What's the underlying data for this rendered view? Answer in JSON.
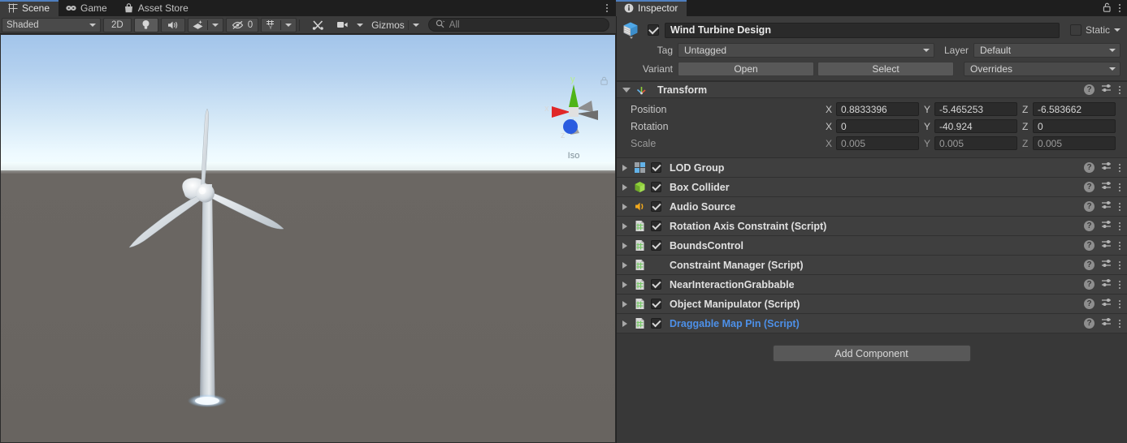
{
  "scene_panel": {
    "tabs": [
      {
        "label": "Scene",
        "icon": "grid-icon",
        "active": true
      },
      {
        "label": "Game",
        "icon": "gamepad-icon",
        "active": false
      },
      {
        "label": "Asset Store",
        "icon": "store-bag-icon",
        "active": false
      }
    ],
    "panel_menu_icon": "kebab-menu-icon",
    "toolbar": {
      "draw_mode": "Shaded",
      "two_d_label": "2D",
      "lighting_icon": "lightbulb-icon",
      "audio_icon": "speaker-icon",
      "fx_icon": "effects-icon",
      "hidden_count": "0",
      "hidden_icon": "eye-slash-icon",
      "grid_icon": "grid-snap-icon",
      "tools_icon": "tools-icon",
      "camera_icon": "camera-icon",
      "gizmos_label": "Gizmos",
      "search_placeholder": "All",
      "search_value": "",
      "search_icon": "search-icon"
    },
    "viewport": {
      "gizmo": {
        "x_label": "x",
        "y_label": "y",
        "z_label": "z",
        "projection": "Iso",
        "lock_icon": "padlock-icon",
        "x_color": "#e02828",
        "y_color": "#4fb417",
        "z_color": "#2a5ce0"
      },
      "sky_top_color": "#a2c4ea",
      "sky_bottom_color": "#f4feff",
      "ground_color": "#6a6662",
      "object_name": "wind-turbine-model"
    }
  },
  "inspector": {
    "tab": {
      "label": "Inspector",
      "icon": "info-icon"
    },
    "lock_icon": "padlock-open-icon",
    "menu_icon": "kebab-menu-icon",
    "object": {
      "enabled": true,
      "name": "Wind Turbine Design",
      "icon": "prefab-cube-icon",
      "static_label": "Static",
      "static_checked": false
    },
    "tag": {
      "label": "Tag",
      "value": "Untagged"
    },
    "layer": {
      "label": "Layer",
      "value": "Default"
    },
    "variant": {
      "label": "Variant",
      "open_label": "Open",
      "select_label": "Select",
      "overrides_label": "Overrides"
    },
    "transform": {
      "title": "Transform",
      "icon": "transform-axes-icon",
      "expanded": true,
      "help_icon": "help-icon",
      "preset_icon": "preset-sliders-icon",
      "menu_icon": "kebab-menu-icon",
      "rows": [
        {
          "name": "Position",
          "dim": false,
          "x": "0.8833396",
          "y": "-5.465253",
          "z": "-6.583662"
        },
        {
          "name": "Rotation",
          "dim": false,
          "x": "0",
          "y": "-40.924",
          "z": "0"
        },
        {
          "name": "Scale",
          "dim": true,
          "x": "0.005",
          "y": "0.005",
          "z": "0.005"
        }
      ],
      "axis_labels": {
        "x": "X",
        "y": "Y",
        "z": "Z"
      }
    },
    "components": [
      {
        "name": "LOD Group",
        "icon": "lod-group-icon",
        "icon_color": "#63b2e8",
        "checkbox": true,
        "checked": true,
        "highlight": false
      },
      {
        "name": "Box Collider",
        "icon": "box-collider-icon",
        "icon_color": "#8fd03a",
        "checkbox": true,
        "checked": true,
        "highlight": false
      },
      {
        "name": "Audio Source",
        "icon": "audio-source-icon",
        "icon_color": "#f0a81e",
        "checkbox": true,
        "checked": true,
        "highlight": false
      },
      {
        "name": "Rotation Axis Constraint (Script)",
        "icon": "script-icon",
        "icon_color": "#7ac96a",
        "checkbox": true,
        "checked": true,
        "highlight": false
      },
      {
        "name": "BoundsControl",
        "icon": "script-icon",
        "icon_color": "#7ac96a",
        "checkbox": true,
        "checked": true,
        "highlight": false
      },
      {
        "name": "Constraint Manager (Script)",
        "icon": "script-icon",
        "icon_color": "#7ac96a",
        "checkbox": false,
        "checked": false,
        "highlight": false
      },
      {
        "name": "NearInteractionGrabbable",
        "icon": "script-icon",
        "icon_color": "#7ac96a",
        "checkbox": true,
        "checked": true,
        "highlight": false
      },
      {
        "name": "Object Manipulator (Script)",
        "icon": "script-icon",
        "icon_color": "#7ac96a",
        "checkbox": true,
        "checked": true,
        "highlight": false
      },
      {
        "name": "Draggable Map Pin (Script)",
        "icon": "script-icon",
        "icon_color": "#7ac96a",
        "checkbox": true,
        "checked": true,
        "highlight": true
      }
    ],
    "component_row_icons": {
      "help": "help-icon",
      "preset": "preset-sliders-icon",
      "menu": "kebab-menu-icon"
    },
    "add_component_label": "Add Component",
    "highlight_color": "#4d90e8"
  }
}
